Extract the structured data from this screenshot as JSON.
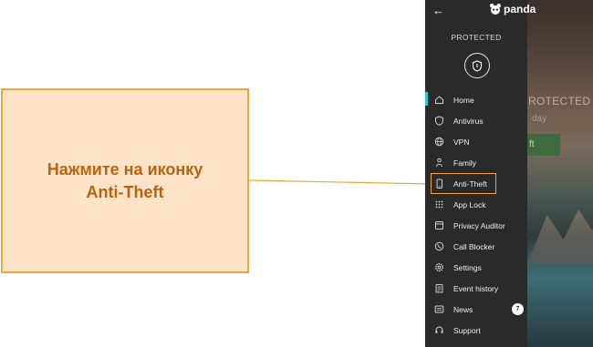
{
  "callout": {
    "text": "Нажмите на иконку\nAnti-Theft"
  },
  "app": {
    "logo_text": "panda",
    "status": "PROTECTED",
    "background": {
      "status_text": "ROTECTED",
      "sub_text": "day",
      "button_label": "ft"
    }
  },
  "menu": [
    {
      "label": "Home",
      "icon": "home-icon",
      "active": true
    },
    {
      "label": "Antivirus",
      "icon": "shield-icon"
    },
    {
      "label": "VPN",
      "icon": "globe-icon"
    },
    {
      "label": "Family",
      "icon": "family-icon"
    },
    {
      "label": "Anti-Theft",
      "icon": "phone-icon",
      "highlighted": true
    },
    {
      "label": "App Lock",
      "icon": "grid-icon"
    },
    {
      "label": "Privacy Auditor",
      "icon": "auditor-icon"
    },
    {
      "label": "Call Blocker",
      "icon": "call-block-icon"
    },
    {
      "label": "Settings",
      "icon": "gear-icon"
    },
    {
      "label": "Event history",
      "icon": "history-icon"
    },
    {
      "label": "News",
      "icon": "news-icon",
      "badge": "7"
    },
    {
      "label": "Support",
      "icon": "support-icon"
    }
  ],
  "colors": {
    "callout_bg": "#fde3c8",
    "callout_border": "#f0a53a",
    "callout_text": "#b86412",
    "drawer_bg": "#2a2a2a",
    "active_indicator": "#31c3e0"
  }
}
